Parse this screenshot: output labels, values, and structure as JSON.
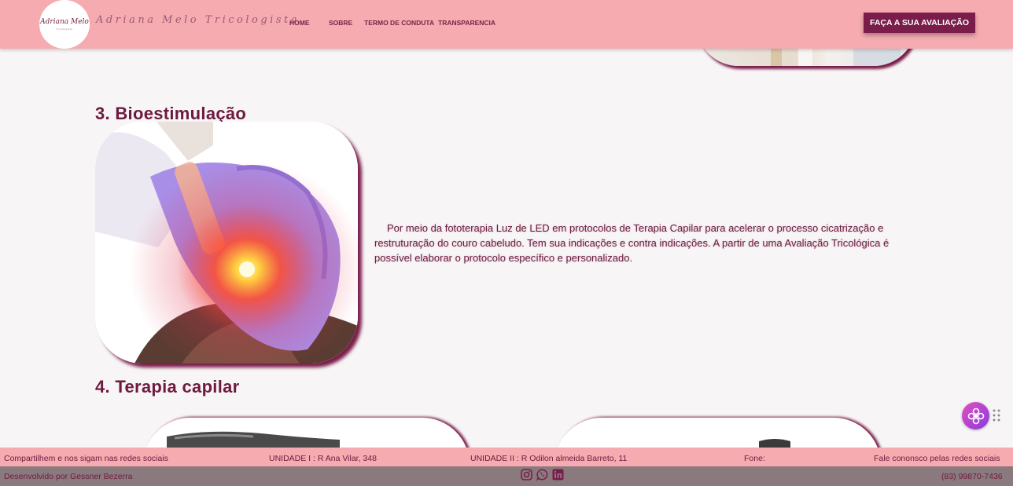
{
  "header": {
    "logo_text": "Adriana Melo",
    "logo_sub": "Tricologista",
    "brand": "Adriana Melo Tricologista",
    "nav": [
      {
        "label": "HOME"
      },
      {
        "label": "SOBRE"
      },
      {
        "label": "TERMO DE CONDUTA"
      },
      {
        "label": "TRANSPARENCIA"
      }
    ],
    "cta_label": "FAÇA A SUA AVALIAÇÃO"
  },
  "main": {
    "section3_title": "3. Bioestimulação",
    "section3_text": "Por meio da fototerapia Luz de LED em protocolos de Terapia Capilar para acelerar o processo cicatrização e restruturação do couro cabeludo. Tem sua indicações e contra indicações. A partir de uma Avaliação Tricológica é possível elaborar o protocolo específico e personalizado.",
    "section4_title": "4. Terapia capilar"
  },
  "footer": {
    "share": "Compartilhem e nos sigam nas redes sociais",
    "unit1": "UNIDADE I : R Ana Vilar, 348",
    "unit2": "UNIDADE II : R Odilon almeida Barreto, 11",
    "phone_label": "Fone:",
    "contact": "Fale cononsco pelas redes sociais",
    "developer": "Desenvolvido por Gessner Bezerra",
    "phone": "(83) 99870-7436"
  },
  "icons": {
    "social": [
      "instagram-icon",
      "whatsapp-icon",
      "linkedin-icon"
    ],
    "widget": "accessibility-widget-icon"
  },
  "colors": {
    "header_bg": "#f5abb0",
    "accent": "#7a1d4a",
    "footer_bottom_bg": "#8a7a7e",
    "page_bg": "#f7f5f5"
  }
}
